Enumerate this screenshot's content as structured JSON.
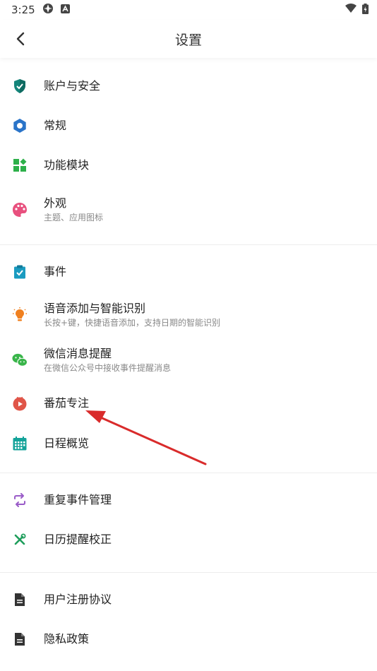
{
  "status_bar": {
    "time": "3:25"
  },
  "header": {
    "title": "设置"
  },
  "sections": [
    {
      "items": [
        {
          "label": "账户与安全",
          "subtitle": ""
        },
        {
          "label": "常规",
          "subtitle": ""
        },
        {
          "label": "功能模块",
          "subtitle": ""
        },
        {
          "label": "外观",
          "subtitle": "主题、应用图标"
        }
      ]
    },
    {
      "items": [
        {
          "label": "事件",
          "subtitle": ""
        },
        {
          "label": "语音添加与智能识别",
          "subtitle": "长按+键，快捷语音添加，支持日期的智能识别"
        },
        {
          "label": "微信消息提醒",
          "subtitle": "在微信公众号中接收事件提醒消息"
        },
        {
          "label": "番茄专注",
          "subtitle": ""
        },
        {
          "label": "日程概览",
          "subtitle": ""
        }
      ]
    },
    {
      "items": [
        {
          "label": "重复事件管理",
          "subtitle": ""
        },
        {
          "label": "日历提醒校正",
          "subtitle": ""
        }
      ]
    },
    {
      "items": [
        {
          "label": "用户注册协议",
          "subtitle": ""
        },
        {
          "label": "隐私政策",
          "subtitle": ""
        }
      ]
    }
  ],
  "colors": {
    "shield": "#14857a",
    "gear": "#2a74c9",
    "modules": "#2db04a",
    "palette": "#e8507e",
    "event": "#1a9bc0",
    "voice": "#f0801f",
    "wechat": "#39b54a",
    "tomato": "#e05548",
    "overview": "#14a39a",
    "repeat": "#9a5cc8",
    "tools": "#1f9e5c",
    "doc": "#333333",
    "annotation": "#d92b2b"
  }
}
